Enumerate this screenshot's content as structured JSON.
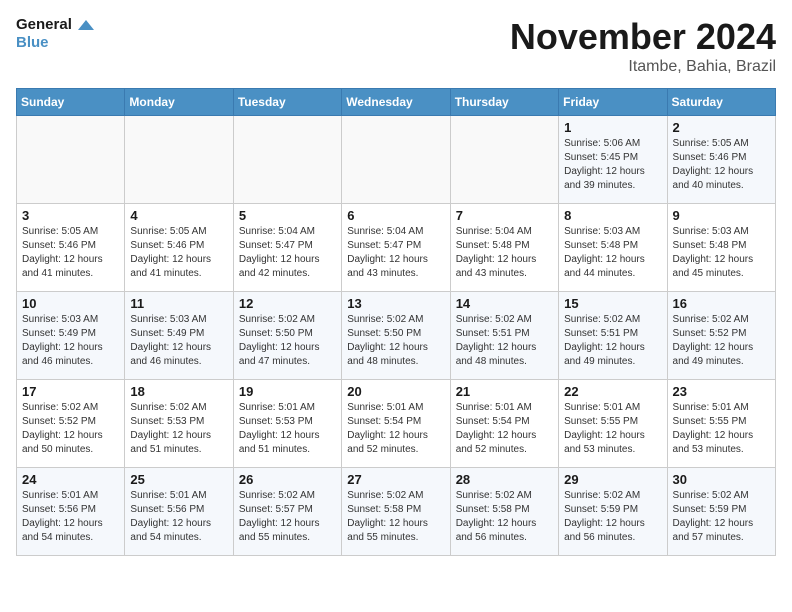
{
  "logo": {
    "line1": "General",
    "line2": "Blue"
  },
  "title": "November 2024",
  "location": "Itambe, Bahia, Brazil",
  "weekdays": [
    "Sunday",
    "Monday",
    "Tuesday",
    "Wednesday",
    "Thursday",
    "Friday",
    "Saturday"
  ],
  "weeks": [
    [
      {
        "day": "",
        "info": ""
      },
      {
        "day": "",
        "info": ""
      },
      {
        "day": "",
        "info": ""
      },
      {
        "day": "",
        "info": ""
      },
      {
        "day": "",
        "info": ""
      },
      {
        "day": "1",
        "info": "Sunrise: 5:06 AM\nSunset: 5:45 PM\nDaylight: 12 hours and 39 minutes."
      },
      {
        "day": "2",
        "info": "Sunrise: 5:05 AM\nSunset: 5:46 PM\nDaylight: 12 hours and 40 minutes."
      }
    ],
    [
      {
        "day": "3",
        "info": "Sunrise: 5:05 AM\nSunset: 5:46 PM\nDaylight: 12 hours and 41 minutes."
      },
      {
        "day": "4",
        "info": "Sunrise: 5:05 AM\nSunset: 5:46 PM\nDaylight: 12 hours and 41 minutes."
      },
      {
        "day": "5",
        "info": "Sunrise: 5:04 AM\nSunset: 5:47 PM\nDaylight: 12 hours and 42 minutes."
      },
      {
        "day": "6",
        "info": "Sunrise: 5:04 AM\nSunset: 5:47 PM\nDaylight: 12 hours and 43 minutes."
      },
      {
        "day": "7",
        "info": "Sunrise: 5:04 AM\nSunset: 5:48 PM\nDaylight: 12 hours and 43 minutes."
      },
      {
        "day": "8",
        "info": "Sunrise: 5:03 AM\nSunset: 5:48 PM\nDaylight: 12 hours and 44 minutes."
      },
      {
        "day": "9",
        "info": "Sunrise: 5:03 AM\nSunset: 5:48 PM\nDaylight: 12 hours and 45 minutes."
      }
    ],
    [
      {
        "day": "10",
        "info": "Sunrise: 5:03 AM\nSunset: 5:49 PM\nDaylight: 12 hours and 46 minutes."
      },
      {
        "day": "11",
        "info": "Sunrise: 5:03 AM\nSunset: 5:49 PM\nDaylight: 12 hours and 46 minutes."
      },
      {
        "day": "12",
        "info": "Sunrise: 5:02 AM\nSunset: 5:50 PM\nDaylight: 12 hours and 47 minutes."
      },
      {
        "day": "13",
        "info": "Sunrise: 5:02 AM\nSunset: 5:50 PM\nDaylight: 12 hours and 48 minutes."
      },
      {
        "day": "14",
        "info": "Sunrise: 5:02 AM\nSunset: 5:51 PM\nDaylight: 12 hours and 48 minutes."
      },
      {
        "day": "15",
        "info": "Sunrise: 5:02 AM\nSunset: 5:51 PM\nDaylight: 12 hours and 49 minutes."
      },
      {
        "day": "16",
        "info": "Sunrise: 5:02 AM\nSunset: 5:52 PM\nDaylight: 12 hours and 49 minutes."
      }
    ],
    [
      {
        "day": "17",
        "info": "Sunrise: 5:02 AM\nSunset: 5:52 PM\nDaylight: 12 hours and 50 minutes."
      },
      {
        "day": "18",
        "info": "Sunrise: 5:02 AM\nSunset: 5:53 PM\nDaylight: 12 hours and 51 minutes."
      },
      {
        "day": "19",
        "info": "Sunrise: 5:01 AM\nSunset: 5:53 PM\nDaylight: 12 hours and 51 minutes."
      },
      {
        "day": "20",
        "info": "Sunrise: 5:01 AM\nSunset: 5:54 PM\nDaylight: 12 hours and 52 minutes."
      },
      {
        "day": "21",
        "info": "Sunrise: 5:01 AM\nSunset: 5:54 PM\nDaylight: 12 hours and 52 minutes."
      },
      {
        "day": "22",
        "info": "Sunrise: 5:01 AM\nSunset: 5:55 PM\nDaylight: 12 hours and 53 minutes."
      },
      {
        "day": "23",
        "info": "Sunrise: 5:01 AM\nSunset: 5:55 PM\nDaylight: 12 hours and 53 minutes."
      }
    ],
    [
      {
        "day": "24",
        "info": "Sunrise: 5:01 AM\nSunset: 5:56 PM\nDaylight: 12 hours and 54 minutes."
      },
      {
        "day": "25",
        "info": "Sunrise: 5:01 AM\nSunset: 5:56 PM\nDaylight: 12 hours and 54 minutes."
      },
      {
        "day": "26",
        "info": "Sunrise: 5:02 AM\nSunset: 5:57 PM\nDaylight: 12 hours and 55 minutes."
      },
      {
        "day": "27",
        "info": "Sunrise: 5:02 AM\nSunset: 5:58 PM\nDaylight: 12 hours and 55 minutes."
      },
      {
        "day": "28",
        "info": "Sunrise: 5:02 AM\nSunset: 5:58 PM\nDaylight: 12 hours and 56 minutes."
      },
      {
        "day": "29",
        "info": "Sunrise: 5:02 AM\nSunset: 5:59 PM\nDaylight: 12 hours and 56 minutes."
      },
      {
        "day": "30",
        "info": "Sunrise: 5:02 AM\nSunset: 5:59 PM\nDaylight: 12 hours and 57 minutes."
      }
    ]
  ]
}
